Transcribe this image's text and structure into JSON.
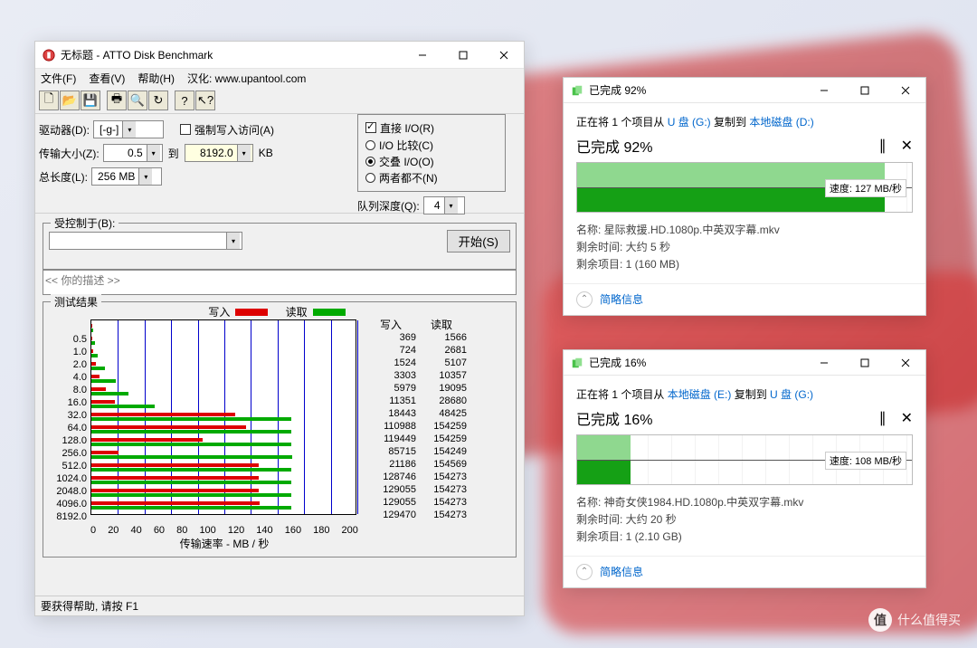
{
  "atto": {
    "title": "无标题 - ATTO Disk Benchmark",
    "menu": {
      "file": "文件(F)",
      "view": "查看(V)",
      "help": "帮助(H)",
      "locale": "汉化: www.upantool.com"
    },
    "toolbar_icons": [
      "new",
      "open",
      "save",
      "print",
      "zoom",
      "refresh",
      "help",
      "cursor"
    ],
    "labels": {
      "drive": "驱动器(D):",
      "drive_val": "[-g-]",
      "force_write": "强制写入访问(A)",
      "direct_io": "直接 I/O(R)",
      "xfer": "传输大小(Z):",
      "xfer_from": "0.5",
      "to": "到",
      "xfer_to": "8192.0",
      "kb": "KB",
      "io_compare": "I/O 比较(C)",
      "overlap": "交叠 I/O(O)",
      "neither": "两者都不(N)",
      "total_len": "总长度(L):",
      "total_val": "256 MB",
      "queue": "队列深度(Q):",
      "queue_val": "4",
      "controlled": "受控制于(B):",
      "start": "开始(S)",
      "desc_placeholder": "<< 你的描述 >>",
      "result_title": "测试结果",
      "write_legend": "写入",
      "read_legend": "读取",
      "xaxis": "传输速率 - MB / 秒",
      "write_col": "写入",
      "read_col": "读取"
    },
    "status": "要获得帮助, 请按 F1"
  },
  "chart_data": {
    "type": "bar",
    "title": "测试结果",
    "xlabel": "传输速率 - MB / 秒",
    "ylabel": "",
    "xlim": [
      0,
      200
    ],
    "xticks": [
      0,
      20,
      40,
      60,
      80,
      100,
      120,
      140,
      160,
      180,
      200
    ],
    "categories": [
      "0.5",
      "1.0",
      "2.0",
      "4.0",
      "8.0",
      "16.0",
      "32.0",
      "64.0",
      "128.0",
      "256.0",
      "512.0",
      "1024.0",
      "2048.0",
      "4096.0",
      "8192.0"
    ],
    "series": [
      {
        "name": "写入",
        "color": "#d00",
        "values_kb": [
          369,
          724,
          1524,
          3303,
          5979,
          11351,
          18443,
          110988,
          119449,
          85715,
          21186,
          128746,
          129055,
          129055,
          129470
        ]
      },
      {
        "name": "读取",
        "color": "#0a0",
        "values_kb": [
          1566,
          2681,
          5107,
          10357,
          19095,
          28680,
          48425,
          154259,
          154259,
          154249,
          154569,
          154273,
          154273,
          154273,
          154273
        ]
      }
    ],
    "unit_note": "column values are KB/s; bars plotted as MB/s (value/1024)"
  },
  "copy1": {
    "title": "已完成 92%",
    "line_pre": "正在将 1 个项目从 ",
    "src": "U 盘 (G:)",
    "mid": " 复制到 ",
    "dst": "本地磁盘 (D:)",
    "percent_text": "已完成 92%",
    "percent": 92,
    "speed": "速度: 127 MB/秒",
    "name_lbl": "名称: ",
    "name_val": "星际救援.HD.1080p.中英双字幕.mkv",
    "remain_lbl": "剩余时间: ",
    "remain_val": "大约 5 秒",
    "items_lbl": "剩余项目: ",
    "items_val": "1 (160 MB)",
    "details": "简略信息"
  },
  "copy2": {
    "title": "已完成 16%",
    "line_pre": "正在将 1 个项目从 ",
    "src": "本地磁盘 (E:)",
    "mid": " 复制到 ",
    "dst": "U 盘 (G:)",
    "percent_text": "已完成 16%",
    "percent": 16,
    "speed": "速度: 108 MB/秒",
    "name_lbl": "名称: ",
    "name_val": "神奇女侠1984.HD.1080p.中英双字幕.mkv",
    "remain_lbl": "剩余时间: ",
    "remain_val": "大约 20 秒",
    "items_lbl": "剩余项目: ",
    "items_val": "1 (2.10 GB)",
    "details": "简略信息"
  },
  "watermark": "什么值得买"
}
